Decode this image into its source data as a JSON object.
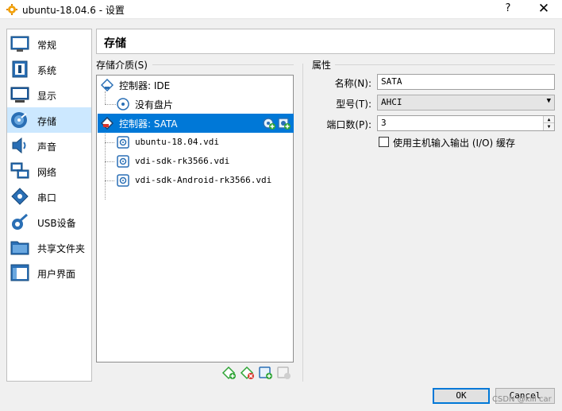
{
  "window": {
    "title": "ubuntu-18.04.6 - 设置",
    "help": "?",
    "close": "✕"
  },
  "sidebar": {
    "items": [
      {
        "label": "常规",
        "icon": "general-icon"
      },
      {
        "label": "系统",
        "icon": "system-icon"
      },
      {
        "label": "显示",
        "icon": "display-icon"
      },
      {
        "label": "存储",
        "icon": "storage-icon",
        "selected": true
      },
      {
        "label": "声音",
        "icon": "audio-icon"
      },
      {
        "label": "网络",
        "icon": "network-icon"
      },
      {
        "label": "串口",
        "icon": "serial-port-icon"
      },
      {
        "label": "USB设备",
        "icon": "usb-icon"
      },
      {
        "label": "共享文件夹",
        "icon": "shared-folder-icon"
      },
      {
        "label": "用户界面",
        "icon": "user-interface-icon"
      }
    ]
  },
  "page": {
    "title": "存储"
  },
  "storage": {
    "section_label": "存储介质(S)",
    "tree": [
      {
        "label": "控制器: IDE",
        "type": "controller"
      },
      {
        "label": "没有盘片",
        "type": "optical"
      },
      {
        "label": "控制器: SATA",
        "type": "controller",
        "selected": true
      },
      {
        "label": "ubuntu-18.04.vdi",
        "type": "disk"
      },
      {
        "label": "vdi-sdk-rk3566.vdi",
        "type": "disk"
      },
      {
        "label": "vdi-sdk-Android-rk3566.vdi",
        "type": "disk"
      }
    ],
    "toolbar": {
      "add_controller": "add-controller-icon",
      "remove_controller": "remove-controller-icon",
      "add_attachment": "add-attachment-icon",
      "remove_attachment": "remove-attachment-icon"
    }
  },
  "attributes": {
    "section_label": "属性",
    "name_label": "名称(N):",
    "name_value": "SATA",
    "type_label": "型号(T):",
    "type_value": "AHCI",
    "ports_label": "端口数(P):",
    "ports_value": "3",
    "host_io_label": "使用主机输入输出 (I/O) 缓存",
    "host_io_checked": false
  },
  "buttons": {
    "ok": "OK",
    "cancel": "Cancel"
  },
  "watermark": "CSDN @kill car",
  "colors": {
    "selection": "#0078d7",
    "sidebar_selection": "#cce8ff"
  }
}
